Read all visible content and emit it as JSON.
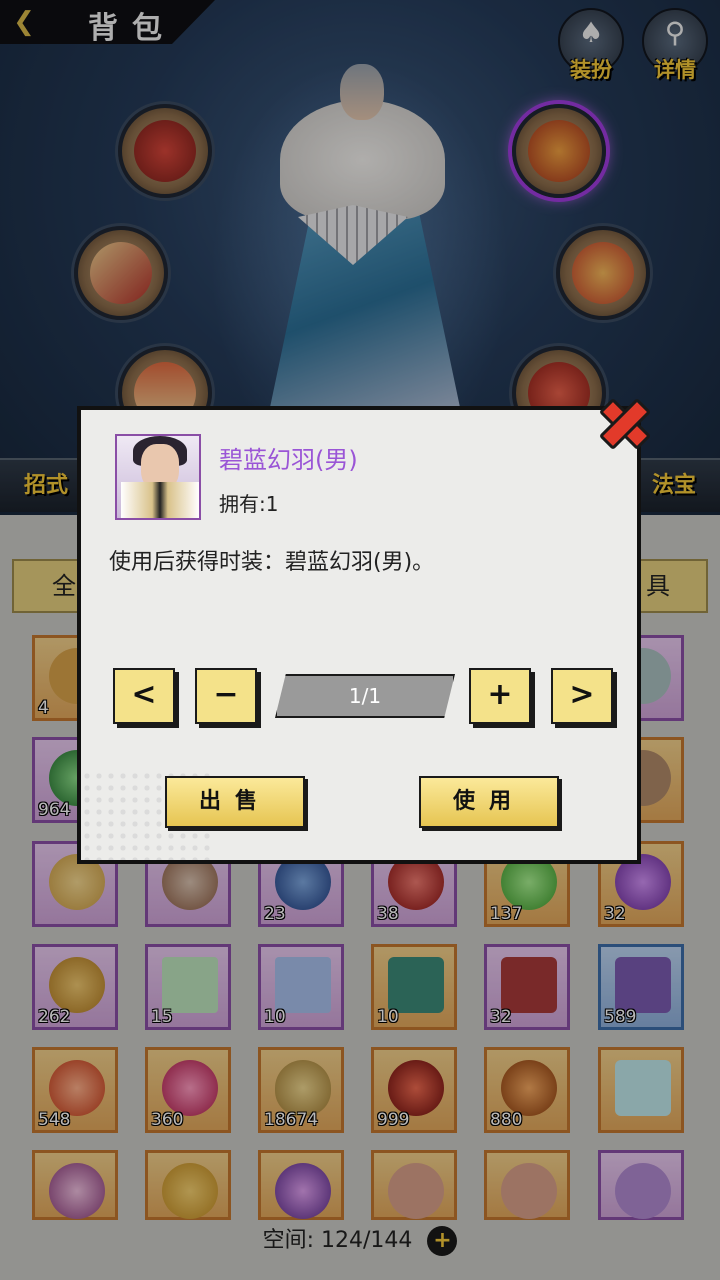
{
  "header": {
    "back_icon": "❮",
    "title": "背包"
  },
  "top_buttons": [
    {
      "label": "装扮",
      "icon": "assassin-hood-icon",
      "glyph": "♠"
    },
    {
      "label": "详情",
      "icon": "magnifier-icon",
      "glyph": "⚲"
    }
  ],
  "side_tabs": {
    "left": "招式",
    "right": "法宝"
  },
  "bag": {
    "tab_all": "全",
    "tab_tools": "具",
    "space_label": "空间:",
    "space_value": "124/144",
    "add_glyph": "+"
  },
  "grid_counts": {
    "r1": [
      "4",
      "",
      "",
      "",
      "",
      ""
    ],
    "r2": [
      "964",
      "",
      "",
      "",
      "",
      ""
    ],
    "r3": [
      "",
      "",
      "23",
      "38",
      "137",
      "32"
    ],
    "r4": [
      "262",
      "15",
      "10",
      "10",
      "32",
      "589"
    ],
    "r5": [
      "548",
      "360",
      "18674",
      "999",
      "880",
      ""
    ],
    "r6": [
      "",
      "",
      "",
      "",
      "",
      ""
    ]
  },
  "modal": {
    "item_name": "碧蓝幻羽(男)",
    "owned": "拥有:1",
    "description": "使用后获得时装：碧蓝幻羽(男)。",
    "prev": "<",
    "minus": "−",
    "quantity": "1/1",
    "plus": "+",
    "next": ">",
    "sell": "出售",
    "use": "使用"
  },
  "colors": {
    "accent": "#f5c93a",
    "item_name": "#9a55d6",
    "close": "#e23a2a",
    "button": "#f4e28a"
  }
}
